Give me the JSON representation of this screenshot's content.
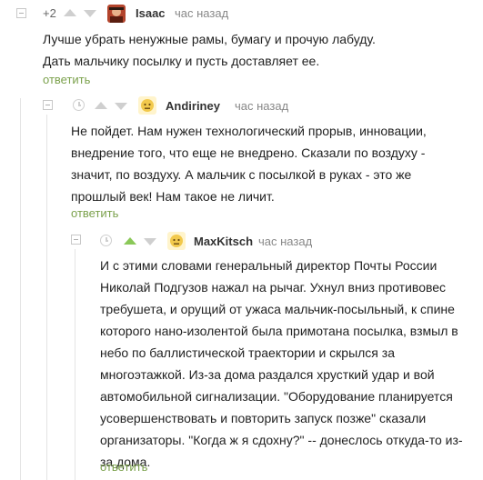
{
  "comments": [
    {
      "score": "+2",
      "author": "Isaac",
      "time": "час назад",
      "text": "Лучше убрать ненужные рамы, бумагу и прочую лабуду. Дать мальчику посылку и пусть доставляет ее.",
      "reply_label": "ответить"
    },
    {
      "author": "Andiriney",
      "time": "час назад",
      "text": "Не пойдет. Нам нужен технологический прорыв, инновации, внедрение того, что еще не внедрено. Сказали по воздуху - значит, по воздуху. А мальчик с посылкой в руках - это же прошлый век! Нам такое не личит.",
      "reply_label": "ответить"
    },
    {
      "author": "MaxKitsch",
      "time": "час назад",
      "text": "И с этими словами генеральный директор Почты России Николай Подгузов нажал на рычаг. Ухнул вниз противовес требушета, и орущий от ужаса мальчик-посыльный, к спине которого нано-изолентой была примотана посылка, взмыл в небо по баллистической траектории и скрылся за многоэтажкой. Из-за дома раздался хрусткий удар и вой автомобильной сигнализации. \"Оборудование планируется усовершенствовать и повторить запуск позже\" сказали организаторы. \"Когда ж я сдохну?\" -- донеслось откуда-то из-за дома.",
      "reply_label": "ответить"
    }
  ],
  "colors": {
    "reply": "#7ba14c",
    "vote_active": "#8ac858",
    "vote_inactive": "#cfcfcf"
  },
  "icons": [
    "collapse-icon",
    "clock-icon",
    "upvote-icon",
    "downvote-icon",
    "avatar"
  ]
}
